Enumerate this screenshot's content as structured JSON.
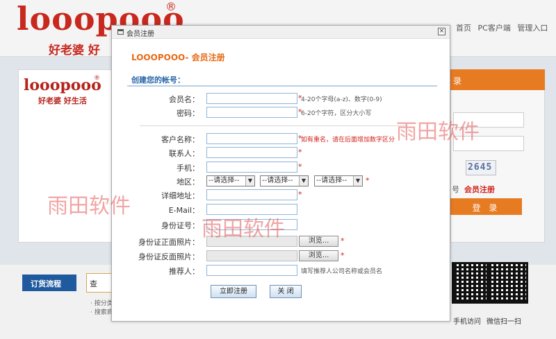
{
  "background": {
    "logo_text": "looopooo",
    "logo_reg": "®",
    "logo_slogan": "好老婆 好",
    "top_links": [
      "首页",
      "PC客户端",
      "管理入口"
    ],
    "small_logo_text": "looopooo",
    "small_logo_reg": "®",
    "small_logo_slogan": "好老婆 好生活",
    "login_tab_fragment": "录",
    "captcha_text": "2645",
    "login_fragment": "号",
    "register_link": "会员注册",
    "login_button": "登 录",
    "order_flow_label": "订货流程",
    "search_fragment": "查",
    "footer_fragment_1": "· 按分类",
    "footer_fragment_2": "· 搜索商",
    "qr_caption_1": "手机访问",
    "qr_caption_2": "微信扫一扫"
  },
  "watermarks": [
    "雨田软件",
    "雨田软件",
    "雨田软件"
  ],
  "modal": {
    "window_title": "会员注册",
    "close_glyph": "×",
    "heading": "LOOOPOOO- 会员注册",
    "section_title": "创建您的帐号：",
    "required_mark": "*",
    "fields": {
      "member_name": {
        "label": "会员名：",
        "value": "",
        "hint": "4-20个字母(a-z)、数字(0-9)"
      },
      "password": {
        "label": "密码：",
        "value": "",
        "hint": "6-20个字符，区分大小写"
      },
      "customer_name": {
        "label": "客户名称：",
        "value": "",
        "hint": "如有重名，请在后面增加数字区分"
      },
      "contact": {
        "label": "联系人：",
        "value": ""
      },
      "mobile": {
        "label": "手机：",
        "value": ""
      },
      "region": {
        "label": "地区：",
        "selects": [
          "--请选择--",
          "--请选择--",
          "--请选择--"
        ]
      },
      "address": {
        "label": "详细地址：",
        "value": ""
      },
      "email": {
        "label": "E-Mail：",
        "value": ""
      },
      "id_number": {
        "label": "身份证号：",
        "value": ""
      },
      "id_front": {
        "label": "身份证正面照片：",
        "browse": "浏览..."
      },
      "id_back": {
        "label": "身份证反面照片：",
        "browse": "浏览..."
      },
      "referrer": {
        "label": "推荐人：",
        "value": "",
        "hint": "填写推荐人公司名称或会员名"
      }
    },
    "submit_label": "立即注册",
    "close_label": "关 闭"
  },
  "colors": {
    "brand_red": "#c8281e",
    "accent_orange": "#e66a14",
    "section_blue": "#2a67a8",
    "required_red": "#d2231a"
  },
  "icons": [
    "window-icon",
    "close-icon",
    "dropdown-arrow-icon",
    "qr-code-icon"
  ]
}
